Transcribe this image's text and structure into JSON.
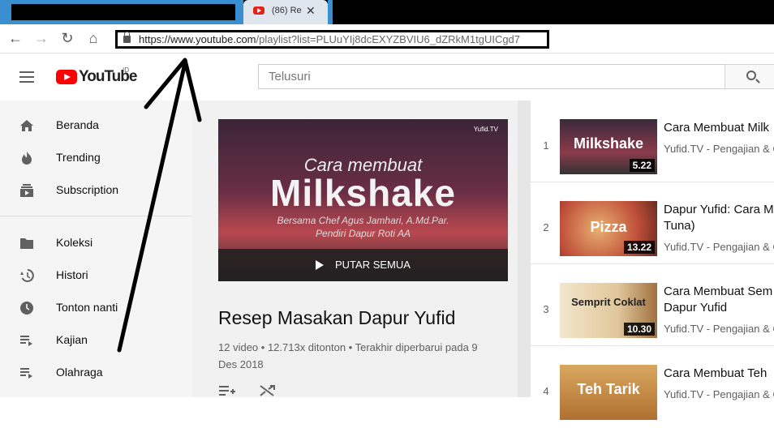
{
  "browser": {
    "tab_title": "(86) Re",
    "url_host": "https://www.youtube.com",
    "url_path": "/playlist?list=PLUuYIj8dcEXYZBVIU6_dZRkM1tgUICgd7"
  },
  "header": {
    "logo_text": "YouTube",
    "logo_region": "ID",
    "search_placeholder": "Telusuri"
  },
  "sidebar": {
    "items": [
      {
        "label": "Beranda",
        "icon": "home-icon"
      },
      {
        "label": "Trending",
        "icon": "flame-icon"
      },
      {
        "label": "Subscription",
        "icon": "subscription-icon"
      },
      {
        "label": "Koleksi",
        "icon": "folder-icon"
      },
      {
        "label": "Histori",
        "icon": "history-icon"
      },
      {
        "label": "Tonton nanti",
        "icon": "clock-icon"
      },
      {
        "label": "Kajian",
        "icon": "playlist-icon"
      },
      {
        "label": "Olahraga",
        "icon": "playlist-icon"
      }
    ]
  },
  "hero": {
    "brand": "Yufid.TV",
    "line1": "Cara membuat",
    "title": "Milkshake",
    "line2": "Bersama Chef Agus Jamhari, A.Md.Par.",
    "line3": "Pendiri Dapur Roti AA",
    "play_all": "PUTAR SEMUA"
  },
  "playlist": {
    "title": "Resep Masakan Dapur Yufid",
    "count": "12 video",
    "views": "12.713x ditonton",
    "updated": "Terakhir diperbarui pada 9 Des 2018"
  },
  "videos": [
    {
      "num": "1",
      "thumb": "Milkshake",
      "duration": "5.22",
      "title": "Cara Membuat Milk",
      "title2": "",
      "channel": "Yufid.TV - Pengajian & C"
    },
    {
      "num": "2",
      "thumb": "Pizza",
      "duration": "13.22",
      "title": "Dapur Yufid: Cara M",
      "title2": "Tuna)",
      "channel": "Yufid.TV - Pengajian & C"
    },
    {
      "num": "3",
      "thumb": "Semprit Coklat",
      "duration": "10.30",
      "title": "Cara Membuat Sem",
      "title2": "Dapur Yufid",
      "channel": "Yufid.TV - Pengajian & C"
    },
    {
      "num": "4",
      "thumb": "Teh Tarik",
      "duration": "",
      "title": "Cara Membuat Teh",
      "title2": "",
      "channel": "Yufid.TV - Pengajian & C"
    }
  ]
}
